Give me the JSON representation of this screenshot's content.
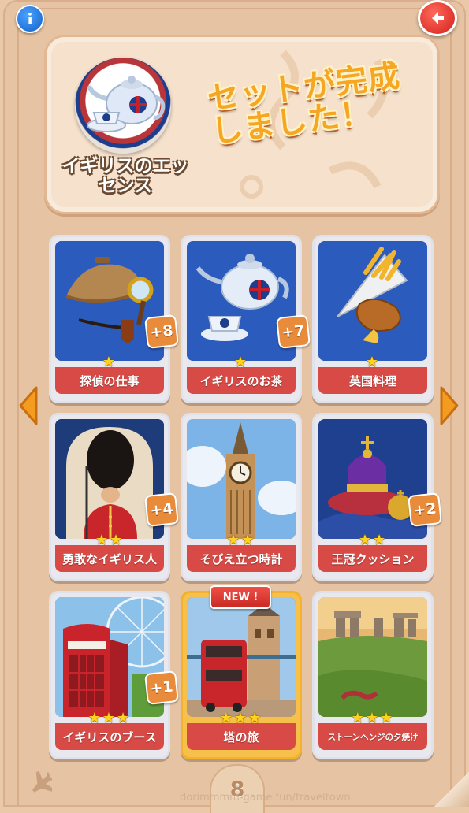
{
  "header": {
    "info_icon": "info-icon",
    "back_icon": "back-arrow-icon"
  },
  "banner": {
    "set_name": "イギリスのエッセンス",
    "complete_message": "セットが完成しました！"
  },
  "cards": [
    {
      "label": "探偵の仕事",
      "stars": 1,
      "duplicates": "+8",
      "icon": "detective-hat-pipe-icon"
    },
    {
      "label": "イギリスのお茶",
      "stars": 1,
      "duplicates": "+7",
      "icon": "teapot-icon"
    },
    {
      "label": "英国料理",
      "stars": 1,
      "duplicates": "",
      "icon": "fish-and-chips-icon"
    },
    {
      "label": "勇敢なイギリス人",
      "stars": 2,
      "duplicates": "+4",
      "icon": "royal-guard-icon"
    },
    {
      "label": "そびえ立つ時計",
      "stars": 2,
      "duplicates": "",
      "icon": "big-ben-icon"
    },
    {
      "label": "王冠クッション",
      "stars": 2,
      "duplicates": "+2",
      "icon": "crown-cushion-icon"
    },
    {
      "label": "イギリスのブース",
      "stars": 3,
      "duplicates": "+1",
      "icon": "phone-booth-icon"
    },
    {
      "label": "塔の旅",
      "stars": 3,
      "duplicates": "",
      "icon": "tower-bridge-bus-icon",
      "badge": "NEW !"
    },
    {
      "label": "ストーンヘンジの夕焼け",
      "stars": 3,
      "duplicates": "",
      "icon": "stonehenge-icon"
    }
  ],
  "footer": {
    "page_number": "8",
    "plane_icon": "airplane-icon",
    "watermark": "dorimmmm-game.fun/traveltown"
  },
  "colors": {
    "background": "#e6c4a3",
    "label_red": "#d84a45",
    "star_yellow": "#ffd21c",
    "accent_orange": "#f5a623"
  }
}
